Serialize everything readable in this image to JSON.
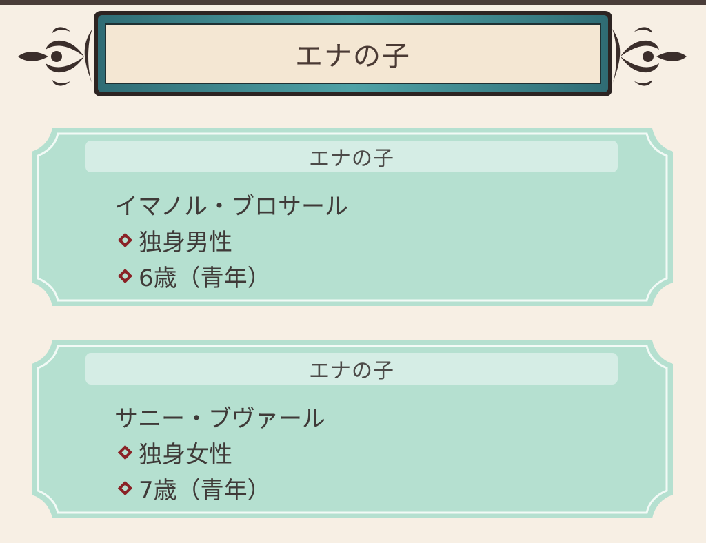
{
  "header": {
    "title": "エナの子"
  },
  "cards": [
    {
      "heading": "エナの子",
      "name": "イマノル・ブロサール",
      "status": "独身男性",
      "age": "6歳（青年）"
    },
    {
      "heading": "エナの子",
      "name": "サニー・ブヴァール",
      "status": "独身女性",
      "age": "7歳（青年）"
    }
  ],
  "icons": {
    "bullet": "diamond-icon",
    "ornament": "fleur-ornament-icon"
  },
  "colors": {
    "background": "#f7efe4",
    "card": "#b5e0d0",
    "card_head": "#d5ede5",
    "bullet": "#8a2226",
    "title_frame": "#2f6c74"
  }
}
